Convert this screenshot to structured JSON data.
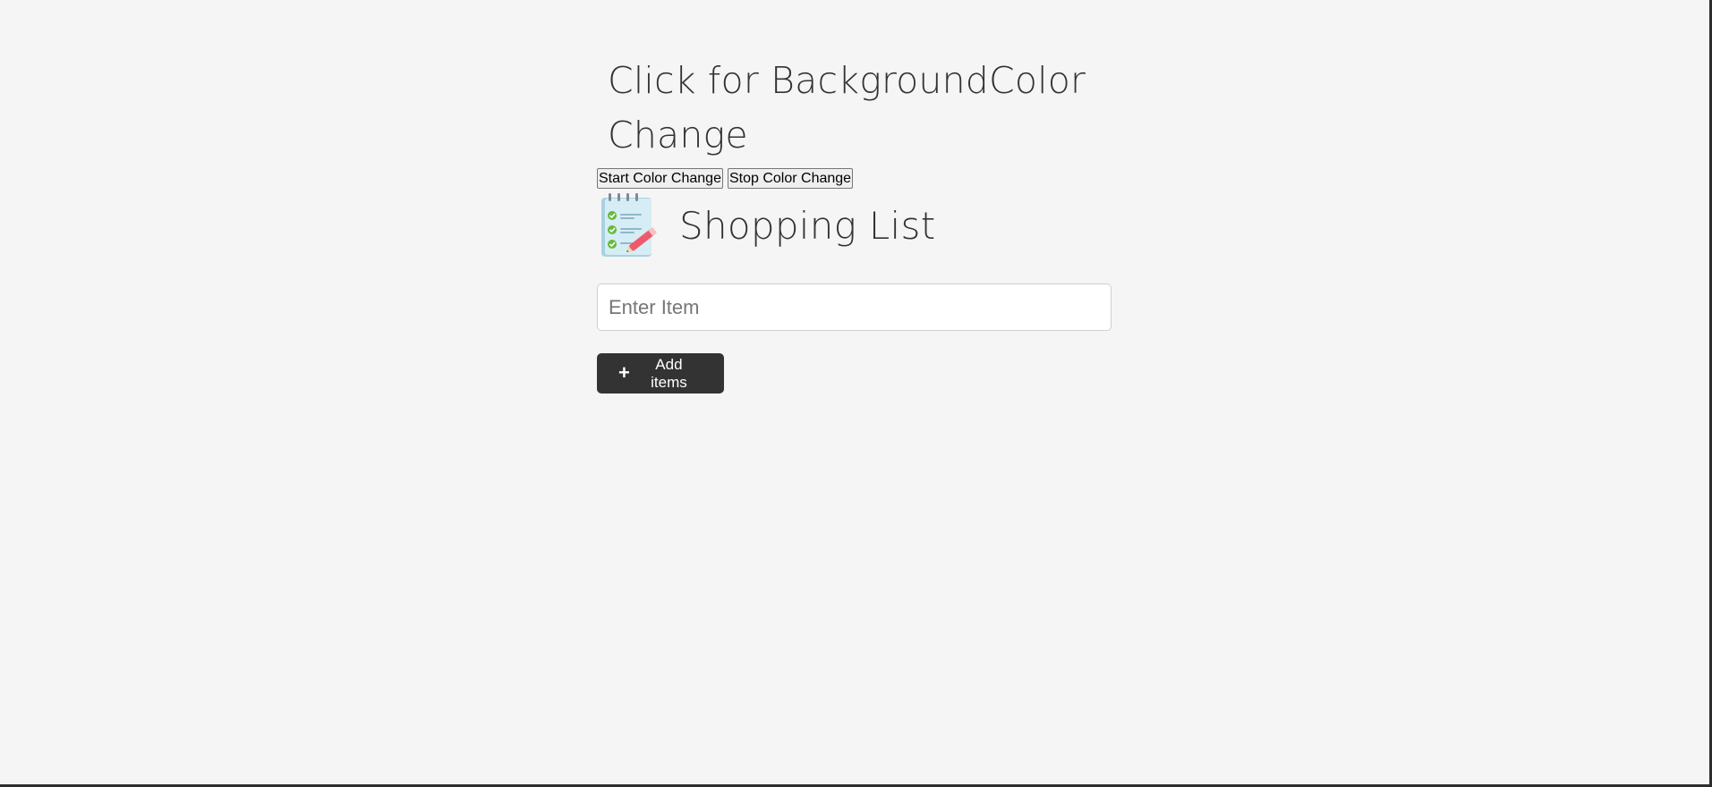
{
  "heading": {
    "text": "Click for BackgroundColor Change"
  },
  "color_controls": {
    "start_label": "Start Color Change",
    "stop_label": "Stop Color Change"
  },
  "shopping": {
    "icon": "notepad-checklist-icon",
    "title": "Shopping List"
  },
  "item_input": {
    "value": "",
    "placeholder": "Enter Item"
  },
  "add_button": {
    "icon": "plus-icon",
    "icon_glyph": "+",
    "label": "Add items"
  },
  "colors": {
    "background": "#f5f5f5",
    "primary_button": "#333333",
    "text": "#333333"
  }
}
